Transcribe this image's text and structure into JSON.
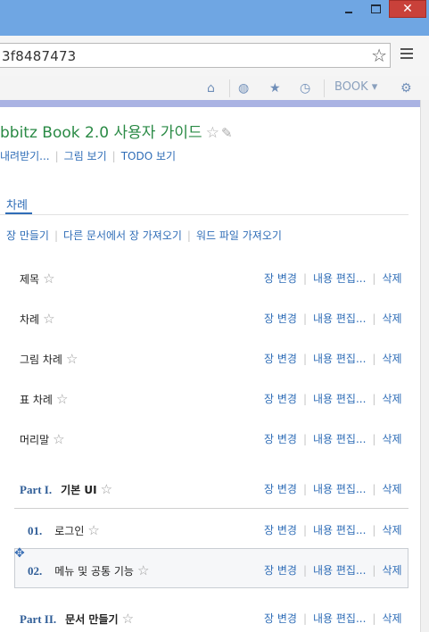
{
  "window": {
    "close_glyph": "✕"
  },
  "browser": {
    "address": "3f8487473",
    "bookmark_icon": "star-outline-icon",
    "menu_icon": "hamburger-menu-icon"
  },
  "appbar": {
    "icons": [
      "home-icon",
      "globe-icon",
      "star-icon",
      "clock-icon",
      "settings-gear-icon"
    ],
    "book_menu_label": "BOOK ▾"
  },
  "page": {
    "title": "bbitz Book 2.0 사용자 가이드",
    "sub_links": [
      "내려받기...",
      "그림 보기",
      "TODO 보기"
    ],
    "tab_label": "차례",
    "actions": [
      "장 만들기",
      "다른 문서에서 장 가져오기",
      "워드 파일 가져오기"
    ]
  },
  "row_actions": [
    "장 변경",
    "내용 편집...",
    "삭제"
  ],
  "rows": [
    {
      "num": "",
      "label": "제목",
      "kind": "plain"
    },
    {
      "num": "",
      "label": "차례",
      "kind": "plain"
    },
    {
      "num": "",
      "label": "그림 차례",
      "kind": "plain"
    },
    {
      "num": "",
      "label": "표 차례",
      "kind": "plain"
    },
    {
      "num": "",
      "label": "머리말",
      "kind": "plain"
    },
    {
      "num": "Part I.",
      "label": "기본 UI",
      "kind": "part"
    },
    {
      "num": "01.",
      "label": "로그인",
      "kind": "chapter"
    },
    {
      "num": "02.",
      "label": "메뉴 및 공통 기능",
      "kind": "chapter"
    },
    {
      "num": "Part II.",
      "label": "문서 만들기",
      "kind": "part"
    }
  ],
  "colors": {
    "link": "#2f6db7",
    "title_green": "#2a8a45",
    "titlebar": "#6fa6e3",
    "accent_bar": "#aab3e3"
  }
}
